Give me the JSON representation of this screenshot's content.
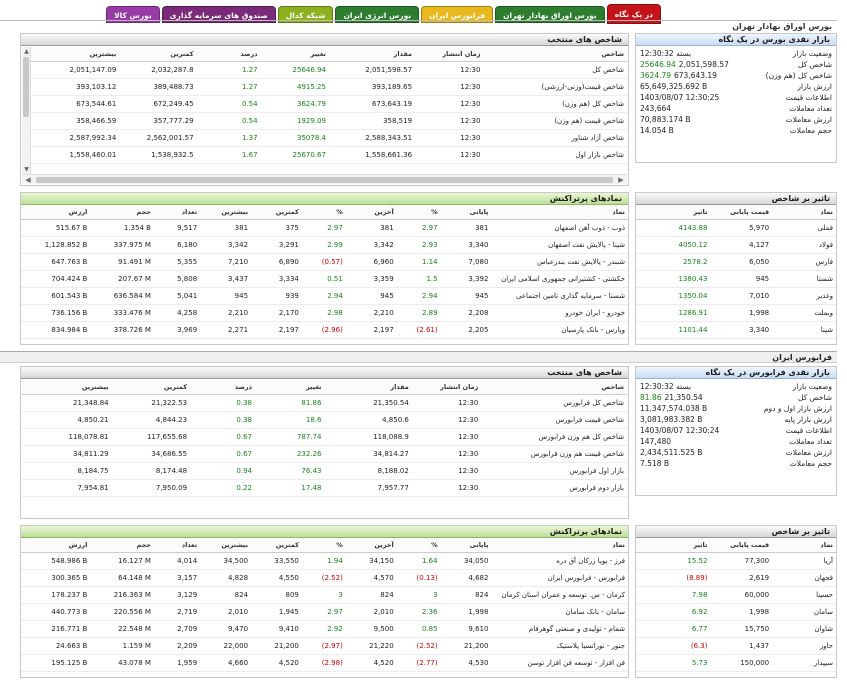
{
  "tabs": [
    {
      "label": "در یک نگاه",
      "color": "#c4141a",
      "active": true
    },
    {
      "label": "بورس اوراق بهادار تهران",
      "color": "#2e7d2e",
      "active": false
    },
    {
      "label": "فرابورس ایران",
      "color": "#e8b81e",
      "active": false
    },
    {
      "label": "بورس انرژی ایران",
      "color": "#2e7d2e",
      "active": false
    },
    {
      "label": "شبکه کدال",
      "color": "#8cb01e",
      "active": false
    },
    {
      "label": "صندوق های سرمایه گذاری",
      "color": "#7a2a78",
      "active": false
    },
    {
      "label": "بورس کالا",
      "color": "#9a3aa8",
      "active": false
    }
  ],
  "page_title": "بورس اوراق بهادار تهران",
  "tse": {
    "summary": {
      "title": "بازار نقدی بورس در یک نگاه",
      "rows": [
        {
          "label": "وضعیت بازار",
          "value": "بسته 12:30:32",
          "green": ""
        },
        {
          "label": "شاخص کل",
          "value": "2,051,598.57",
          "green": "25646.94"
        },
        {
          "label": "شاخص کل (هم وزن)",
          "value": "673,643.19",
          "green": "3624.79"
        },
        {
          "label": "ارزش بازار",
          "value": "65,649,325.692 B",
          "green": ""
        },
        {
          "label": "اطلاعات قیمت",
          "value": "1403/08/07 12:30:25",
          "green": ""
        },
        {
          "label": "تعداد معاملات",
          "value": "243,664",
          "green": ""
        },
        {
          "label": "ارزش معاملات",
          "value": "70,883.174 B",
          "green": ""
        },
        {
          "label": "حجم معاملات",
          "value": "14.054 B",
          "green": ""
        }
      ]
    },
    "indices": {
      "title": "شاخص های منتخب",
      "headers": [
        "شاخص",
        "زمان انتشار",
        "مقدار",
        "تغییر",
        "درصد",
        "کمترین",
        "بیشترین"
      ],
      "rows": [
        [
          "شاخص کل",
          "12:30",
          "2,051,598.57",
          "25646.94",
          "1.27",
          "2,032,287.8",
          "2,051,147.09"
        ],
        [
          "شاخص قیمت(وزنی-ارزشی)",
          "12:30",
          "393,189.65",
          "4915.25",
          "1.27",
          "389,488.73",
          "393,103.12"
        ],
        [
          "شاخص کل (هم وزن)",
          "12:30",
          "673,643.19",
          "3624.79",
          "0.54",
          "672,249.45",
          "673,544.61"
        ],
        [
          "شاخص قیمت (هم وزن)",
          "12:30",
          "358,519",
          "1929.09",
          "0.54",
          "357,777.29",
          "358,466.59"
        ],
        [
          "شاخص آزاد شناور",
          "12:30",
          "2,588,343.51",
          "35078.4",
          "1.37",
          "2,562,001.57",
          "2,587,992.34"
        ],
        [
          "شاخص بازار اول",
          "12:30",
          "1,558,661.36",
          "25670.67",
          "1.67",
          "1,538,932.5",
          "1,558,460.01"
        ]
      ]
    },
    "impact": {
      "title": "تاثیر بر شاخص",
      "headers": [
        "نماد",
        "قیمت پایانی",
        "تاثیر"
      ],
      "rows": [
        [
          "فملی",
          "5,970",
          "4143.88"
        ],
        [
          "فولاد",
          "4,127",
          "4050.12"
        ],
        [
          "فارس",
          "6,050",
          "2578.2"
        ],
        [
          "شستا",
          "945",
          "1380.43"
        ],
        [
          "وغدیر",
          "7,010",
          "1350.04"
        ],
        [
          "وبملت",
          "1,998",
          "1286.91"
        ],
        [
          "شپنا",
          "3,340",
          "1101.44"
        ]
      ]
    },
    "popular": {
      "title": "نمادهای پرتراکنش",
      "headers": [
        "نماد",
        "پایانی",
        "%",
        "آخرین",
        "%",
        "کمترین",
        "بیشترین",
        "تعداد",
        "حجم",
        "ارزش"
      ],
      "rows": [
        [
          "ذوب - ذوب آهن اصفهان",
          "381",
          "2.97",
          "381",
          "2.97",
          "375",
          "381",
          "9,517",
          "1.354 B",
          "515.67 B"
        ],
        [
          "شپنا - پالایش نفت اصفهان",
          "3,340",
          "2.93",
          "3,342",
          "2.99",
          "3,291",
          "3,342",
          "6,180",
          "337.975 M",
          "1,128.852 B"
        ],
        [
          "شبندر - پالایش نفت بندرعباس",
          "7,080",
          "1.14",
          "6,960",
          "(0.57)",
          "6,890",
          "7,210",
          "5,355",
          "91.491 M",
          "647.763 B"
        ],
        [
          "حکشتی - کشتیرانی جمهوری اسلامی ایران",
          "3,392",
          "1.5",
          "3,359",
          "0.51",
          "3,334",
          "3,437",
          "5,808",
          "207.67 M",
          "704.424 B"
        ],
        [
          "شستا - سرمایه گذاری تامین اجتماعی",
          "945",
          "2.94",
          "945",
          "2.94",
          "939",
          "945",
          "5,041",
          "636.584 M",
          "601.543 B"
        ],
        [
          "خودرو - ایران خودرو",
          "2,208",
          "2.89",
          "2,210",
          "2.98",
          "2,170",
          "2,210",
          "4,258",
          "333.476 M",
          "736.156 B"
        ],
        [
          "وپارس - بانک پارسیان",
          "2,205",
          "(2.61)",
          "2,197",
          "(2.96)",
          "2,197",
          "2,271",
          "3,969",
          "378.726 M",
          "834.984 B"
        ]
      ]
    }
  },
  "ifb_title": "فرابورس ایران",
  "ifb": {
    "summary": {
      "title": "بازار نقدی فرابورس در یک نگاه",
      "rows": [
        {
          "label": "وضعیت بازار",
          "value": "بسته 12:30:32",
          "green": ""
        },
        {
          "label": "شاخص کل",
          "value": "21,350.54",
          "green": "81.86"
        },
        {
          "label": "ارزش بازار اول و دوم",
          "value": "11,347,574.038 B",
          "green": ""
        },
        {
          "label": "ارزش بازار پایه",
          "value": "3,081,983.382 B",
          "green": ""
        },
        {
          "label": "اطلاعات قیمت",
          "value": "1403/08/07 12:30:24",
          "green": ""
        },
        {
          "label": "تعداد معاملات",
          "value": "147,480",
          "green": ""
        },
        {
          "label": "ارزش معاملات",
          "value": "2,434,511.525 B",
          "green": ""
        },
        {
          "label": "حجم معاملات",
          "value": "7.518 B",
          "green": ""
        }
      ]
    },
    "indices": {
      "title": "شاخص های منتخب",
      "headers": [
        "شاخص",
        "زمان انتشار",
        "مقدار",
        "تغییر",
        "درصد",
        "کمترین",
        "بیشترین"
      ],
      "rows": [
        [
          "شاخص کل فرابورس",
          "12:30",
          "21,350.54",
          "81.86",
          "0.38",
          "21,322.53",
          "21,348.84"
        ],
        [
          "شاخص قیمت فرابورس",
          "12:30",
          "4,850.6",
          "18.6",
          "0.38",
          "4,844.23",
          "4,850.21"
        ],
        [
          "شاخص کل هم وزن فرابورس",
          "12:30",
          "118,088.9",
          "787.74",
          "0.67",
          "117,655.68",
          "118,078.81"
        ],
        [
          "شاخص قیمت هم وزن فرابورس",
          "12:30",
          "34,814.27",
          "232.26",
          "0.67",
          "34,686.55",
          "34,811.29"
        ],
        [
          "بازار اول فرابورس",
          "12:30",
          "8,188.02",
          "76.43",
          "0.94",
          "8,174.48",
          "8,184.75"
        ],
        [
          "بازار دوم فرابورس",
          "12:30",
          "7,957.77",
          "17.48",
          "0.22",
          "7,950.09",
          "7,954.81"
        ]
      ]
    },
    "impact": {
      "title": "تاثیر بر شاخص",
      "headers": [
        "نماد",
        "قیمت پایانی",
        "تاثیر"
      ],
      "rows": [
        [
          "آریا",
          "77,300",
          "15.52"
        ],
        [
          "فجهان",
          "2,619",
          "(8.89)"
        ],
        [
          "حسینا",
          "60,000",
          "7.98"
        ],
        [
          "سامان",
          "1,998",
          "6.92"
        ],
        [
          "شاوان",
          "15,750",
          "6.77"
        ],
        [
          "حاور",
          "1,437",
          "(6.3)"
        ],
        [
          "سپیدار",
          "150,000",
          "5.73"
        ]
      ]
    },
    "popular": {
      "title": "نمادهای پرتراکنش",
      "headers": [
        "نماد",
        "پایانی",
        "%",
        "آخرین",
        "%",
        "کمترین",
        "بیشترین",
        "تعداد",
        "حجم",
        "ارزش"
      ],
      "rows": [
        [
          "فرز - پویا زرکان آق دره",
          "34,050",
          "1.64",
          "34,150",
          "1.94",
          "33,550",
          "34,500",
          "4,014",
          "16.127 M",
          "548.986 B"
        ],
        [
          "فرابورس - فرابورس ایران",
          "4,682",
          "(0.13)",
          "4,570",
          "(2.52)",
          "4,550",
          "4,828",
          "3,157",
          "64.148 M",
          "300.365 B"
        ],
        [
          "کرمان - س. توسعه و عمران استان کرمان",
          "824",
          "3",
          "824",
          "3",
          "809",
          "824",
          "3,129",
          "216.363 M",
          "178.237 B"
        ],
        [
          "سامان - بانک سامان",
          "1,998",
          "2.36",
          "2,010",
          "2.97",
          "1,945",
          "2,010",
          "2,719",
          "220.556 M",
          "440.773 B"
        ],
        [
          "شمام - تولیدی و صنعتی گوهرفام",
          "9,610",
          "0.85",
          "9,500",
          "2.92",
          "9,410",
          "9,470",
          "2,709",
          "22.548 M",
          "216.771 B"
        ],
        [
          "جنور - نوراتسیا پلاستیک",
          "21,200",
          "(2.52)",
          "21,220",
          "(2.97)",
          "21,200",
          "22,000",
          "2,209",
          "1.159 M",
          "24.663 B"
        ],
        [
          "فن افزار - توسعه فن افزار توسن",
          "4,530",
          "(2.77)",
          "4,520",
          "(2.98)",
          "4,520",
          "4,660",
          "1,959",
          "43.078 M",
          "195.125 B"
        ]
      ]
    }
  }
}
